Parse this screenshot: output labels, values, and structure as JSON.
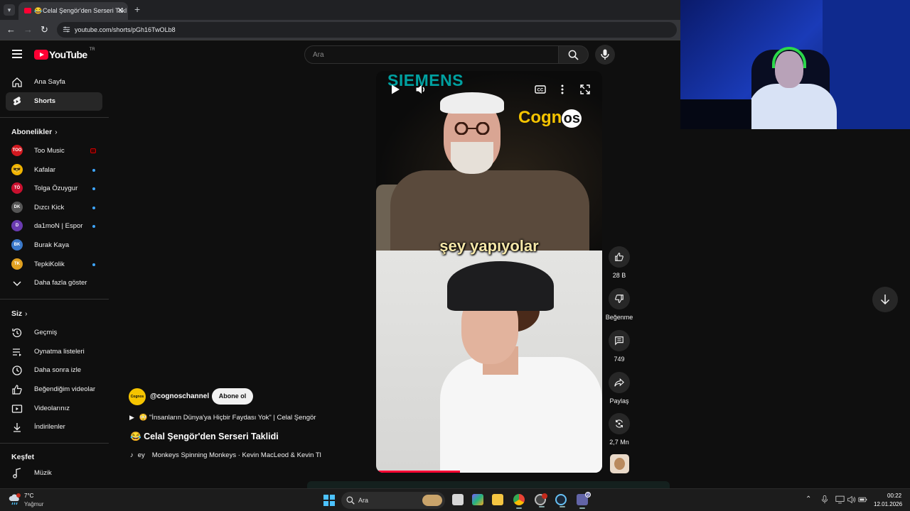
{
  "browser": {
    "tab_title": "Celal Şengör'den Serseri Takl",
    "tab_emoji": "😂",
    "tab_close": "✕",
    "new_tab": "+",
    "url": "youtube.com/shorts/pGh16TwOLb8",
    "nav": {
      "back": "←",
      "forward": "→",
      "reload": "↻"
    }
  },
  "masthead": {
    "logo_text": "YouTube",
    "country": "TR",
    "search_placeholder": "Ara"
  },
  "sidebar": {
    "primary": [
      {
        "label": "Ana Sayfa",
        "icon": "home-icon",
        "active": false
      },
      {
        "label": "Shorts",
        "icon": "shorts-icon",
        "active": true
      }
    ],
    "subscriptions_header": "Abonelikler",
    "subscriptions": [
      {
        "label": "Too Music",
        "badge": "TOO",
        "color": "#d1181f",
        "indicator": "live"
      },
      {
        "label": "Kafalar",
        "badge": "😎",
        "color": "#f0b400",
        "indicator": "dot"
      },
      {
        "label": "Tolga Özuygur",
        "badge": "TÖ",
        "color": "#c8102e",
        "indicator": "dot"
      },
      {
        "label": "Dızcı Kick",
        "badge": "DK",
        "color": "#555555",
        "indicator": "dot"
      },
      {
        "label": "da1moN | Espor",
        "badge": "D",
        "color": "#6a3bb0",
        "indicator": "dot"
      },
      {
        "label": "Burak Kaya",
        "badge": "BK",
        "color": "#3a78c9",
        "indicator": "none"
      },
      {
        "label": "TepkiKolik",
        "badge": "TK",
        "color": "#e0a020",
        "indicator": "dot"
      }
    ],
    "show_more": "Daha fazla göster",
    "you_header": "Siz",
    "you_items": [
      {
        "label": "Geçmiş",
        "icon": "history-icon"
      },
      {
        "label": "Oynatma listeleri",
        "icon": "playlists-icon"
      },
      {
        "label": "Daha sonra izle",
        "icon": "watch-later-icon"
      },
      {
        "label": "Beğendiğim videolar",
        "icon": "liked-videos-icon"
      },
      {
        "label": "Videolarınız",
        "icon": "your-videos-icon"
      },
      {
        "label": "İndirilenler",
        "icon": "downloads-icon"
      }
    ],
    "explore_header": "Keşfet",
    "explore_items": [
      {
        "label": "Müzik",
        "icon": "music-icon"
      }
    ]
  },
  "player": {
    "brand_top": "SIEMENS",
    "brand_overlay_a": "Cogn",
    "brand_overlay_b": "os",
    "caption": "şey yapıyolar",
    "progress": 0.37
  },
  "actions": {
    "likes": "28 B",
    "dislike_label": "Beğenme",
    "comments": "749",
    "share_label": "Paylaş",
    "remix_count": "2,7 Mn"
  },
  "meta": {
    "channel_avatar_text": "Cognos",
    "channel": "@cognoschannel",
    "subscribe": "Abone ol",
    "playlist_emoji": "😳",
    "playlist": "\"İnsanların Dünya'ya Hiçbir Faydası Yok\" | Celal Şengör",
    "title_emoji": "😂",
    "title": "Celal Şengör'den Serseri Taklidi",
    "music_fragment": "ey",
    "music": "Monkeys Spinning Monkeys · Kevin MacLeod & Kevin Tl"
  },
  "taskbar": {
    "weather_temp": "7°C",
    "weather_desc": "Yağmur",
    "search_placeholder": "Ara",
    "chat_badge": "2",
    "time": "00:22",
    "date": "12.01.2026"
  },
  "colors": {
    "accent": "#ff0033",
    "background": "#0f0f0f",
    "caption": "#f5e6a8",
    "brand_yellow": "#f5c400"
  }
}
